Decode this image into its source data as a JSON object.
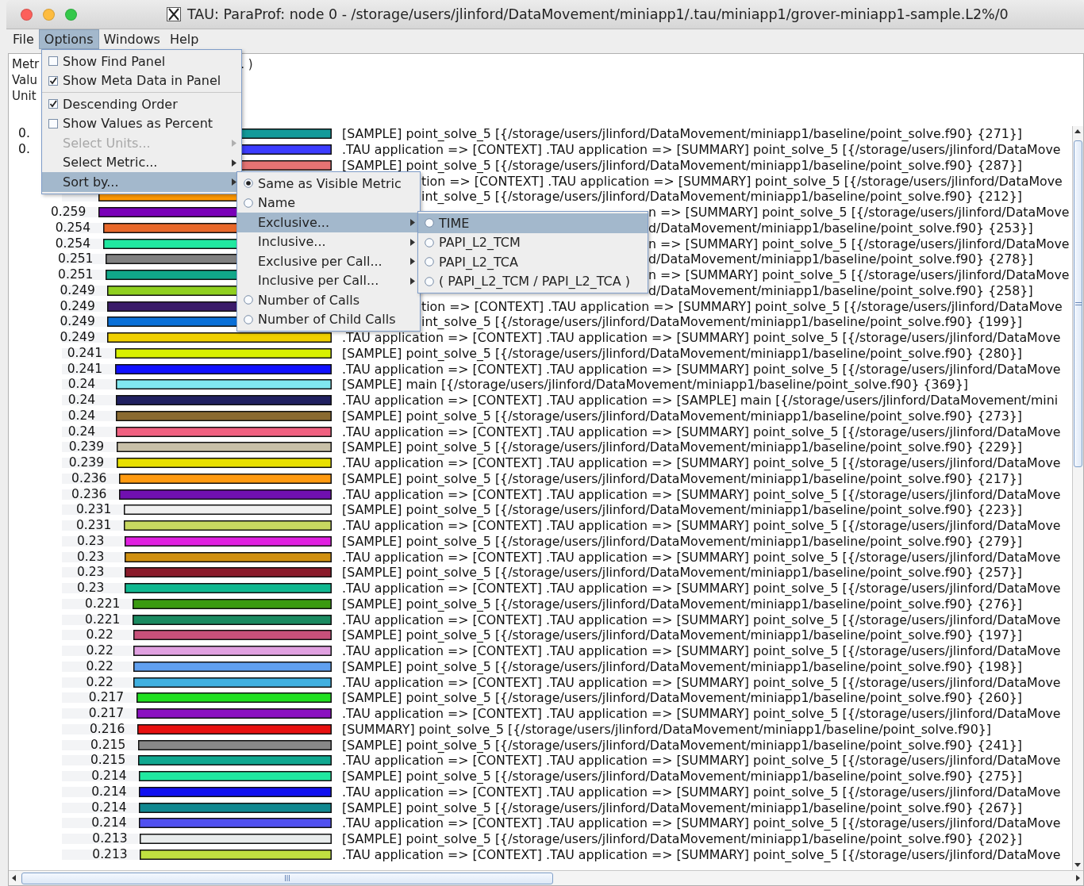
{
  "window": {
    "title": "TAU: ParaProf: node 0 - /storage/users/jlinford/DataMovement/miniapp1/.tau/miniapp1/grover-miniapp1-sample.L2%/0"
  },
  "menubar": [
    {
      "label": "File",
      "selected": false
    },
    {
      "label": "Options",
      "selected": true
    },
    {
      "label": "Windows",
      "selected": false
    },
    {
      "label": "Help",
      "selected": false
    }
  ],
  "header": [
    {
      "text": "Metr",
      "tail": ". )"
    },
    {
      "text": "Valu"
    },
    {
      "text": "Unit"
    }
  ],
  "options_menu": [
    {
      "kind": "check",
      "label": "Show Find Panel",
      "checked": false,
      "selected": false,
      "disabled": false
    },
    {
      "kind": "check",
      "label": "Show Meta Data in Panel",
      "checked": true,
      "selected": false,
      "disabled": false
    },
    {
      "kind": "separator"
    },
    {
      "kind": "check",
      "label": "Descending Order",
      "checked": true,
      "selected": false,
      "disabled": false
    },
    {
      "kind": "check",
      "label": "Show Values as Percent",
      "checked": false,
      "selected": false,
      "disabled": false
    },
    {
      "kind": "submenu",
      "label": "Select Units...",
      "selected": false,
      "disabled": true
    },
    {
      "kind": "submenu",
      "label": "Select Metric...",
      "selected": false,
      "disabled": false
    },
    {
      "kind": "submenu",
      "label": "Sort by...",
      "selected": true,
      "disabled": false
    }
  ],
  "sort_menu": [
    {
      "kind": "radio",
      "label": "Same as Visible Metric",
      "checked": true,
      "selected": false
    },
    {
      "kind": "radio",
      "label": "Name",
      "checked": false,
      "selected": false
    },
    {
      "kind": "submenu",
      "label": "Exclusive...",
      "selected": true
    },
    {
      "kind": "submenu",
      "label": "Inclusive...",
      "selected": false
    },
    {
      "kind": "submenu",
      "label": "Exclusive per Call...",
      "selected": false
    },
    {
      "kind": "submenu",
      "label": "Inclusive per Call...",
      "selected": false
    },
    {
      "kind": "radio",
      "label": "Number of Calls",
      "checked": false,
      "selected": false
    },
    {
      "kind": "radio",
      "label": "Number of Child Calls",
      "checked": false,
      "selected": false
    }
  ],
  "metric_menu": [
    {
      "kind": "radio",
      "label": "TIME",
      "checked": false,
      "selected": true
    },
    {
      "kind": "radio",
      "label": "PAPI_L2_TCM",
      "checked": false,
      "selected": false
    },
    {
      "kind": "radio",
      "label": "PAPI_L2_TCA",
      "checked": false,
      "selected": false
    },
    {
      "kind": "radio",
      "label": "( PAPI_L2_TCM / PAPI_L2_TCA )",
      "checked": false,
      "selected": false
    }
  ],
  "rows": [
    {
      "kind": "full",
      "value": "0.",
      "level": 0.985,
      "color": "#129a9a",
      "label": "[SAMPLE] point_solve_5 [{/storage/users/jlinford/DataMovement/miniapp1/baseline/point_solve.f90}  {271}]"
    },
    {
      "kind": "full",
      "value": "0.",
      "level": 0.985,
      "color": "#3c3cff",
      "label": ".TAU application => [CONTEXT] .TAU application => [SUMMARY] point_solve_5 [{/storage/users/jlinford/DataMove"
    },
    {
      "kind": "full",
      "level": 0.95,
      "color": "#e57373",
      "label": "[SAMPLE] point_solve_5 [{/storage/users/jlinford/DataMovement/miniapp1/baseline/point_solve.f90}  {287}]"
    },
    {
      "kind": "submenu",
      "label": "tion => [CONTEXT] .TAU application => [SUMMARY] point_solve_5 [{/storage/users/jlinford/DataMove"
    },
    {
      "kind": "submenu",
      "level": 0.865,
      "color": "#ff9900",
      "label": "int_solve_5 [{/storage/users/jlinford/DataMovement/miniapp1/baseline/point_solve.f90}  {212}]"
    },
    {
      "kind": "subsubmenu",
      "value": "0.259",
      "level": 0.865,
      "color": "#7a00b8",
      "label": "n => [SUMMARY] point_solve_5 [{/storage/users/jlinford/DataMove"
    },
    {
      "kind": "subsubmenu",
      "value": "0.254",
      "level": 0.848,
      "color": "#e8682a",
      "label": "d/DataMovement/miniapp1/baseline/point_solve.f90}  {253}]"
    },
    {
      "kind": "subsubmenu",
      "value": "0.254",
      "level": 0.848,
      "color": "#20e8a0",
      "label": "n => [SUMMARY] point_solve_5 [{/storage/users/jlinford/DataMove"
    },
    {
      "kind": "subsubmenu",
      "value": "0.251",
      "level": 0.838,
      "color": "#808080",
      "label": "d/DataMovement/miniapp1/baseline/point_solve.f90}  {278}]"
    },
    {
      "kind": "subsubmenu",
      "value": "0.251",
      "level": 0.838,
      "color": "#10a88a",
      "label": "n => [SUMMARY] point_solve_5 [{/storage/users/jlinford/DataMove"
    },
    {
      "kind": "subsubmenu",
      "value": "0.249",
      "level": 0.831,
      "color": "#90d020",
      "label": "d/DataMovement/miniapp1/baseline/point_solve.f90}  {258}]"
    },
    {
      "kind": "submenu",
      "value": "0.249",
      "level": 0.831,
      "color": "#3a1a6a",
      "label": "tion => [CONTEXT] .TAU application => [SUMMARY] point_solve_5 [{/storage/users/jlinford/DataMove"
    },
    {
      "kind": "submenu",
      "value": "0.249",
      "level": 0.831,
      "color": "#0a70d8",
      "label": "int_solve_5 [{/storage/users/jlinford/DataMovement/miniapp1/baseline/point_solve.f90}  {199}]"
    },
    {
      "kind": "full",
      "value": "0.249",
      "level": 0.831,
      "color": "#f0d000",
      "label": ".TAU application => [CONTEXT] .TAU application => [SUMMARY] point_solve_5 [{/storage/users/jlinford/DataMove"
    },
    {
      "kind": "full",
      "value": "0.241",
      "level": 0.804,
      "color": "#d8f000",
      "label": "[SAMPLE] point_solve_5 [{/storage/users/jlinford/DataMovement/miniapp1/baseline/point_solve.f90}  {280}]"
    },
    {
      "kind": "full",
      "value": "0.241",
      "level": 0.804,
      "color": "#1010ff",
      "label": ".TAU application => [CONTEXT] .TAU application => [SUMMARY] point_solve_5 [{/storage/users/jlinford/DataMove"
    },
    {
      "kind": "full",
      "value": "0.24",
      "level": 0.801,
      "color": "#80e8f0",
      "label": "[SAMPLE] main [{/storage/users/jlinford/DataMovement/miniapp1/baseline/point_solve.f90}  {369}]"
    },
    {
      "kind": "full",
      "value": "0.24",
      "level": 0.801,
      "color": "#202060",
      "label": ".TAU application => [CONTEXT] .TAU application => [SAMPLE] main [{/storage/users/jlinford/DataMovement/mini"
    },
    {
      "kind": "full",
      "value": "0.24",
      "level": 0.801,
      "color": "#8a6a30",
      "label": "[SAMPLE] point_solve_5 [{/storage/users/jlinford/DataMovement/miniapp1/baseline/point_solve.f90}  {273}]"
    },
    {
      "kind": "full",
      "value": "0.24",
      "level": 0.801,
      "color": "#f06080",
      "label": ".TAU application => [CONTEXT] .TAU application => [SUMMARY] point_solve_5 [{/storage/users/jlinford/DataMove"
    },
    {
      "kind": "full",
      "value": "0.239",
      "level": 0.798,
      "color": "#c8c0a8",
      "label": "[SAMPLE] point_solve_5 [{/storage/users/jlinford/DataMovement/miniapp1/baseline/point_solve.f90}  {229}]"
    },
    {
      "kind": "full",
      "value": "0.239",
      "level": 0.798,
      "color": "#e8e000",
      "label": ".TAU application => [CONTEXT] .TAU application => [SUMMARY] point_solve_5 [{/storage/users/jlinford/DataMove"
    },
    {
      "kind": "full",
      "value": "0.236",
      "level": 0.788,
      "color": "#ff9a10",
      "label": "[SAMPLE] point_solve_5 [{/storage/users/jlinford/DataMovement/miniapp1/baseline/point_solve.f90}  {217}]"
    },
    {
      "kind": "full",
      "value": "0.236",
      "level": 0.788,
      "color": "#7010b0",
      "label": ".TAU application => [CONTEXT] .TAU application => [SUMMARY] point_solve_5 [{/storage/users/jlinford/DataMove"
    },
    {
      "kind": "full",
      "value": "0.231",
      "level": 0.771,
      "color": "#f0f0f0",
      "label": "[SAMPLE] point_solve_5 [{/storage/users/jlinford/DataMovement/miniapp1/baseline/point_solve.f90}  {223}]"
    },
    {
      "kind": "full",
      "value": "0.231",
      "level": 0.771,
      "color": "#c8d860",
      "label": ".TAU application => [CONTEXT] .TAU application => [SUMMARY] point_solve_5 [{/storage/users/jlinford/DataMove"
    },
    {
      "kind": "full",
      "value": "0.23",
      "level": 0.768,
      "color": "#e020e0",
      "label": "[SAMPLE] point_solve_5 [{/storage/users/jlinford/DataMovement/miniapp1/baseline/point_solve.f90}  {279}]"
    },
    {
      "kind": "full",
      "value": "0.23",
      "level": 0.768,
      "color": "#d09010",
      "label": ".TAU application => [CONTEXT] .TAU application => [SUMMARY] point_solve_5 [{/storage/users/jlinford/DataMove"
    },
    {
      "kind": "full",
      "value": "0.23",
      "level": 0.768,
      "color": "#8a1a2a",
      "label": "[SAMPLE] point_solve_5 [{/storage/users/jlinford/DataMovement/miniapp1/baseline/point_solve.f90}  {257}]"
    },
    {
      "kind": "full",
      "value": "0.23",
      "level": 0.768,
      "color": "#10b890",
      "label": ".TAU application => [CONTEXT] .TAU application => [SUMMARY] point_solve_5 [{/storage/users/jlinford/DataMove"
    },
    {
      "kind": "full",
      "value": "0.221",
      "level": 0.738,
      "color": "#3a9a10",
      "label": "[SAMPLE] point_solve_5 [{/storage/users/jlinford/DataMovement/miniapp1/baseline/point_solve.f90}  {276}]"
    },
    {
      "kind": "full",
      "value": "0.221",
      "level": 0.738,
      "color": "#1a8a60",
      "label": ".TAU application => [CONTEXT] .TAU application => [SUMMARY] point_solve_5 [{/storage/users/jlinford/DataMove"
    },
    {
      "kind": "full",
      "value": "0.22",
      "level": 0.734,
      "color": "#c8507a",
      "label": "[SAMPLE] point_solve_5 [{/storage/users/jlinford/DataMovement/miniapp1/baseline/point_solve.f90}  {197}]"
    },
    {
      "kind": "full",
      "value": "0.22",
      "level": 0.734,
      "color": "#e0a0e0",
      "label": ".TAU application => [CONTEXT] .TAU application => [SUMMARY] point_solve_5 [{/storage/users/jlinford/DataMove"
    },
    {
      "kind": "full",
      "value": "0.22",
      "level": 0.734,
      "color": "#60a0f0",
      "label": "[SAMPLE] point_solve_5 [{/storage/users/jlinford/DataMovement/miniapp1/baseline/point_solve.f90}  {198}]"
    },
    {
      "kind": "full",
      "value": "0.22",
      "level": 0.734,
      "color": "#40b0e0",
      "label": ".TAU application => [CONTEXT] .TAU application => [SUMMARY] point_solve_5 [{/storage/users/jlinford/DataMove"
    },
    {
      "kind": "full",
      "value": "0.217",
      "level": 0.724,
      "color": "#20e020",
      "label": "[SAMPLE] point_solve_5 [{/storage/users/jlinford/DataMovement/miniapp1/baseline/point_solve.f90}  {260}]"
    },
    {
      "kind": "full",
      "value": "0.217",
      "level": 0.724,
      "color": "#8a10c0",
      "label": ".TAU application => [CONTEXT] .TAU application => [SUMMARY] point_solve_5 [{/storage/users/jlinford/DataMove"
    },
    {
      "kind": "full",
      "value": "0.216",
      "level": 0.721,
      "color": "#e81010",
      "label": "[SUMMARY] point_solve_5 [{/storage/users/jlinford/DataMovement/miniapp1/baseline/point_solve.f90}]"
    },
    {
      "kind": "full",
      "value": "0.215",
      "level": 0.718,
      "color": "#888888",
      "label": "[SAMPLE] point_solve_5 [{/storage/users/jlinford/DataMovement/miniapp1/baseline/point_solve.f90}  {241}]"
    },
    {
      "kind": "full",
      "value": "0.215",
      "level": 0.718,
      "color": "#10a890",
      "label": ".TAU application => [CONTEXT] .TAU application => [SUMMARY] point_solve_5 [{/storage/users/jlinford/DataMove"
    },
    {
      "kind": "full",
      "value": "0.214",
      "level": 0.714,
      "color": "#20e8a0",
      "label": "[SAMPLE] point_solve_5 [{/storage/users/jlinford/DataMovement/miniapp1/baseline/point_solve.f90}  {275}]"
    },
    {
      "kind": "full",
      "value": "0.214",
      "level": 0.714,
      "color": "#1010f0",
      "label": ".TAU application => [CONTEXT] .TAU application => [SUMMARY] point_solve_5 [{/storage/users/jlinford/DataMove"
    },
    {
      "kind": "full",
      "value": "0.214",
      "level": 0.714,
      "color": "#108890",
      "label": "[SAMPLE] point_solve_5 [{/storage/users/jlinford/DataMovement/miniapp1/baseline/point_solve.f90}  {267}]"
    },
    {
      "kind": "full",
      "value": "0.214",
      "level": 0.714,
      "color": "#5050f0",
      "label": ".TAU application => [CONTEXT] .TAU application => [SUMMARY] point_solve_5 [{/storage/users/jlinford/DataMove"
    },
    {
      "kind": "full",
      "value": "0.213",
      "level": 0.711,
      "color": "#e8ecec",
      "label": "[SAMPLE] point_solve_5 [{/storage/users/jlinford/DataMovement/miniapp1/baseline/point_solve.f90}  {202}]"
    },
    {
      "kind": "full",
      "value": "0.213",
      "level": 0.711,
      "color": "#c0e040",
      "label": ".TAU application => [CONTEXT] .TAU application => [SUMMARY] point_solve_5 [{/storage/users/jlinford/DataMove"
    }
  ]
}
